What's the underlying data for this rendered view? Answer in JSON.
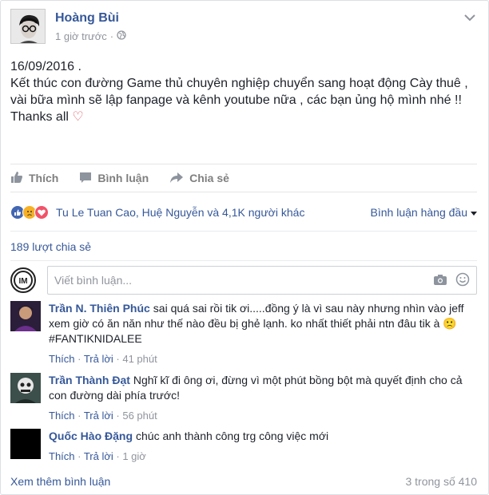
{
  "post": {
    "author": "Hoàng Bùi",
    "time": "1 giờ trước",
    "separator": "·",
    "date_line": "16/09/2016 .",
    "body": "Kết thúc con đường Game thủ chuyên nghiệp chuyển sang hoạt động Cày thuê , vài bữa mình sẽ lập fanpage và kênh youtube nữa , các bạn ủng hộ mình nhé !!",
    "closing": "Thanks all",
    "heart_emoji": "♡"
  },
  "actions": {
    "like": "Thích",
    "comment": "Bình luận",
    "share": "Chia sẻ"
  },
  "reactions": {
    "names": "Tu Le Tuan Cao, Huệ Nguyễn và 4,1K người khác",
    "sort": "Bình luận hàng đầu"
  },
  "shares": "189 lượt chia sẻ",
  "composer": {
    "placeholder": "Viết bình luận..."
  },
  "comments": [
    {
      "name": "Trần N. Thiên Phúc",
      "text": "sai quá sai rồi tik ơi.....đồng ý là vì sau này nhưng nhìn vào jeff xem giờ có ăn năn như thế nào đều bị ghẻ lạnh. ko nhất thiết phải ntn đâu tik à 🙁 #FANTIKNIDALEE",
      "like": "Thích",
      "reply": "Trả lời",
      "time": "41 phút"
    },
    {
      "name": "Trần Thành Đạt",
      "text": "Nghĩ kĩ đi ông ơi, đừng vì một phút bồng bột mà quyết định cho cả con đường dài phía trước!",
      "like": "Thích",
      "reply": "Trả lời",
      "time": "56 phút"
    },
    {
      "name": "Quốc Hào Đặng",
      "text": "chúc anh thành công trg công việc mới",
      "like": "Thích",
      "reply": "Trả lời",
      "time": "1 giờ"
    }
  ],
  "footer": {
    "more": "Xem thêm bình luận",
    "count": "3 trong số 410"
  },
  "colors": {
    "link": "#365899",
    "muted": "#90949c",
    "like_blue": "#4267b2",
    "love_red": "#f25268",
    "sad_yellow": "#f7b125"
  },
  "icons": [
    "globe-icon",
    "chevron-down-icon",
    "like-icon",
    "comment-icon",
    "share-icon",
    "like-reaction-icon",
    "sad-reaction-icon",
    "love-reaction-icon",
    "camera-icon",
    "smiley-icon",
    "caret-down-icon"
  ]
}
